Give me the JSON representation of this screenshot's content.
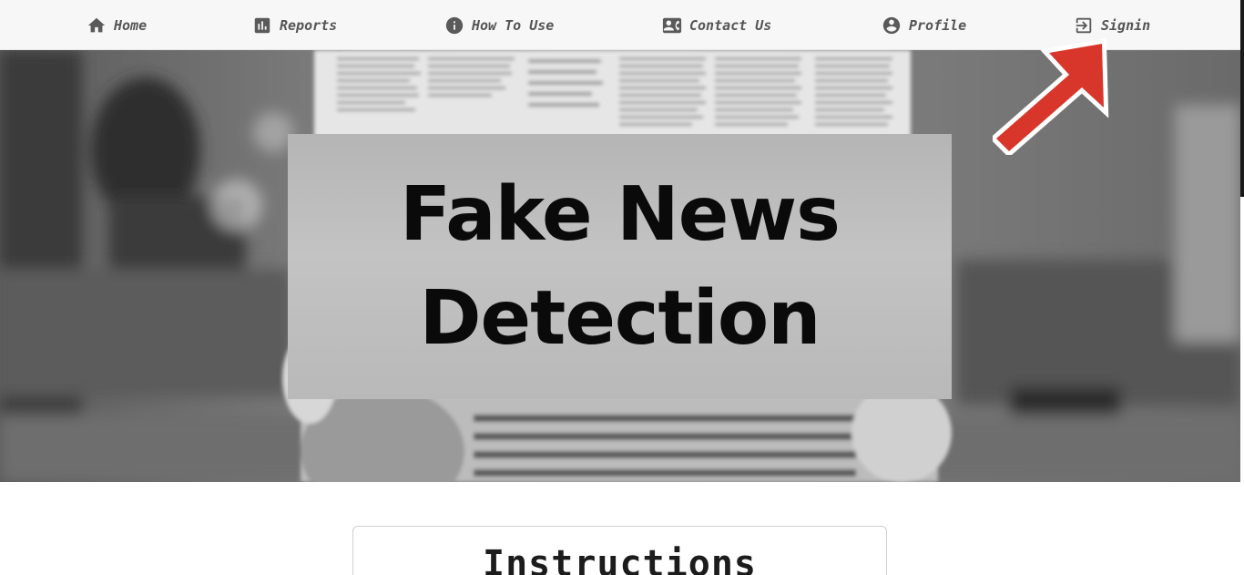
{
  "nav": {
    "home": {
      "label": "Home",
      "icon": "home-icon"
    },
    "reports": {
      "label": "Reports",
      "icon": "bar-chart-icon"
    },
    "how_to_use": {
      "label": "How To Use",
      "icon": "info-icon"
    },
    "contact_us": {
      "label": "Contact Us",
      "icon": "contact-card-icon"
    },
    "profile": {
      "label": "Profile",
      "icon": "account-circle-icon"
    },
    "signin": {
      "label": "Signin",
      "icon": "login-icon"
    }
  },
  "hero": {
    "title_line1": "Fake News",
    "title_line2": "Detection"
  },
  "instructions": {
    "title": "Instructions"
  },
  "colors": {
    "nav_background": "#f7f7f7",
    "nav_text": "#555555",
    "annotation_arrow": "#d9362b"
  }
}
